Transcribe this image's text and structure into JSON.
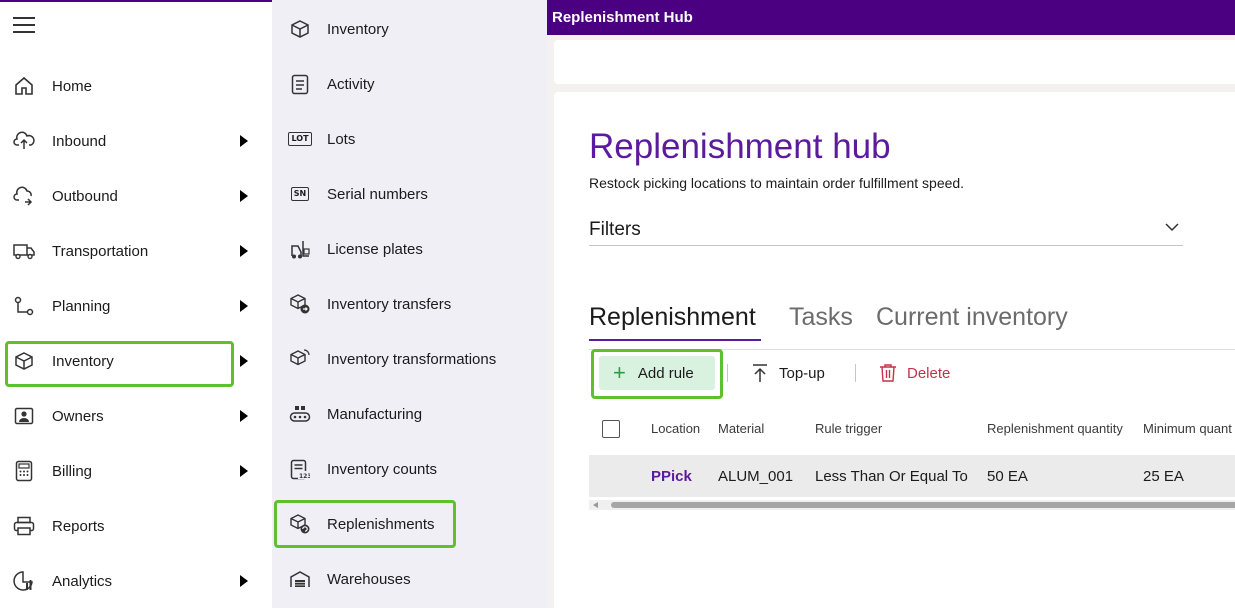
{
  "leftnav": {
    "items": [
      {
        "label": "Home",
        "icon": "home-icon",
        "has_submenu": false
      },
      {
        "label": "Inbound",
        "icon": "inbound-icon",
        "has_submenu": true
      },
      {
        "label": "Outbound",
        "icon": "outbound-icon",
        "has_submenu": true
      },
      {
        "label": "Transportation",
        "icon": "truck-icon",
        "has_submenu": true
      },
      {
        "label": "Planning",
        "icon": "planning-icon",
        "has_submenu": true
      },
      {
        "label": "Inventory",
        "icon": "box-icon",
        "has_submenu": true,
        "selected": true
      },
      {
        "label": "Owners",
        "icon": "owner-icon",
        "has_submenu": true
      },
      {
        "label": "Billing",
        "icon": "calculator-icon",
        "has_submenu": true
      },
      {
        "label": "Reports",
        "icon": "printer-icon",
        "has_submenu": false
      },
      {
        "label": "Analytics",
        "icon": "analytics-icon",
        "has_submenu": true
      }
    ]
  },
  "submenu": {
    "items": [
      {
        "label": "Inventory",
        "icon": "box-icon"
      },
      {
        "label": "Activity",
        "icon": "clipboard-list-icon"
      },
      {
        "label": "Lots",
        "icon": "lot-tag-icon",
        "tag": "LOT"
      },
      {
        "label": "Serial numbers",
        "icon": "serial-tag-icon",
        "tag": "SN"
      },
      {
        "label": "License plates",
        "icon": "forklift-icon"
      },
      {
        "label": "Inventory transfers",
        "icon": "boxes-transfer-icon"
      },
      {
        "label": "Inventory transformations",
        "icon": "box-transform-icon"
      },
      {
        "label": "Manufacturing",
        "icon": "conveyor-icon"
      },
      {
        "label": "Inventory counts",
        "icon": "clipboard-count-icon"
      },
      {
        "label": "Replenishments",
        "icon": "box-replenish-icon",
        "selected": true
      },
      {
        "label": "Warehouses",
        "icon": "warehouse-icon"
      }
    ]
  },
  "main": {
    "window_title": "Replenishment Hub",
    "page_title": "Replenishment hub",
    "subtitle": "Restock picking locations to maintain order fulfillment speed.",
    "filters_label": "Filters",
    "tabs": [
      {
        "label": "Replenishment",
        "active": true
      },
      {
        "label": "Tasks",
        "active": false
      },
      {
        "label": "Current inventory",
        "active": false
      }
    ],
    "toolbar": {
      "add_rule": "Add rule",
      "top_up": "Top-up",
      "delete": "Delete"
    },
    "table": {
      "columns": [
        "Location",
        "Material",
        "Rule trigger",
        "Replenishment quantity",
        "Minimum quant"
      ],
      "rows": [
        {
          "location": "PPick",
          "material": "ALUM_001",
          "rule_trigger": "Less Than Or Equal To",
          "replenishment_quantity": "50 EA",
          "minimum_quantity": "25 EA"
        }
      ]
    }
  },
  "colors": {
    "brand_purple": "#4b0082",
    "title_purple": "#5c1a9c",
    "highlight_green": "#5fc02e",
    "add_button_bg": "#d9f2df",
    "delete_red": "#c4314b"
  }
}
